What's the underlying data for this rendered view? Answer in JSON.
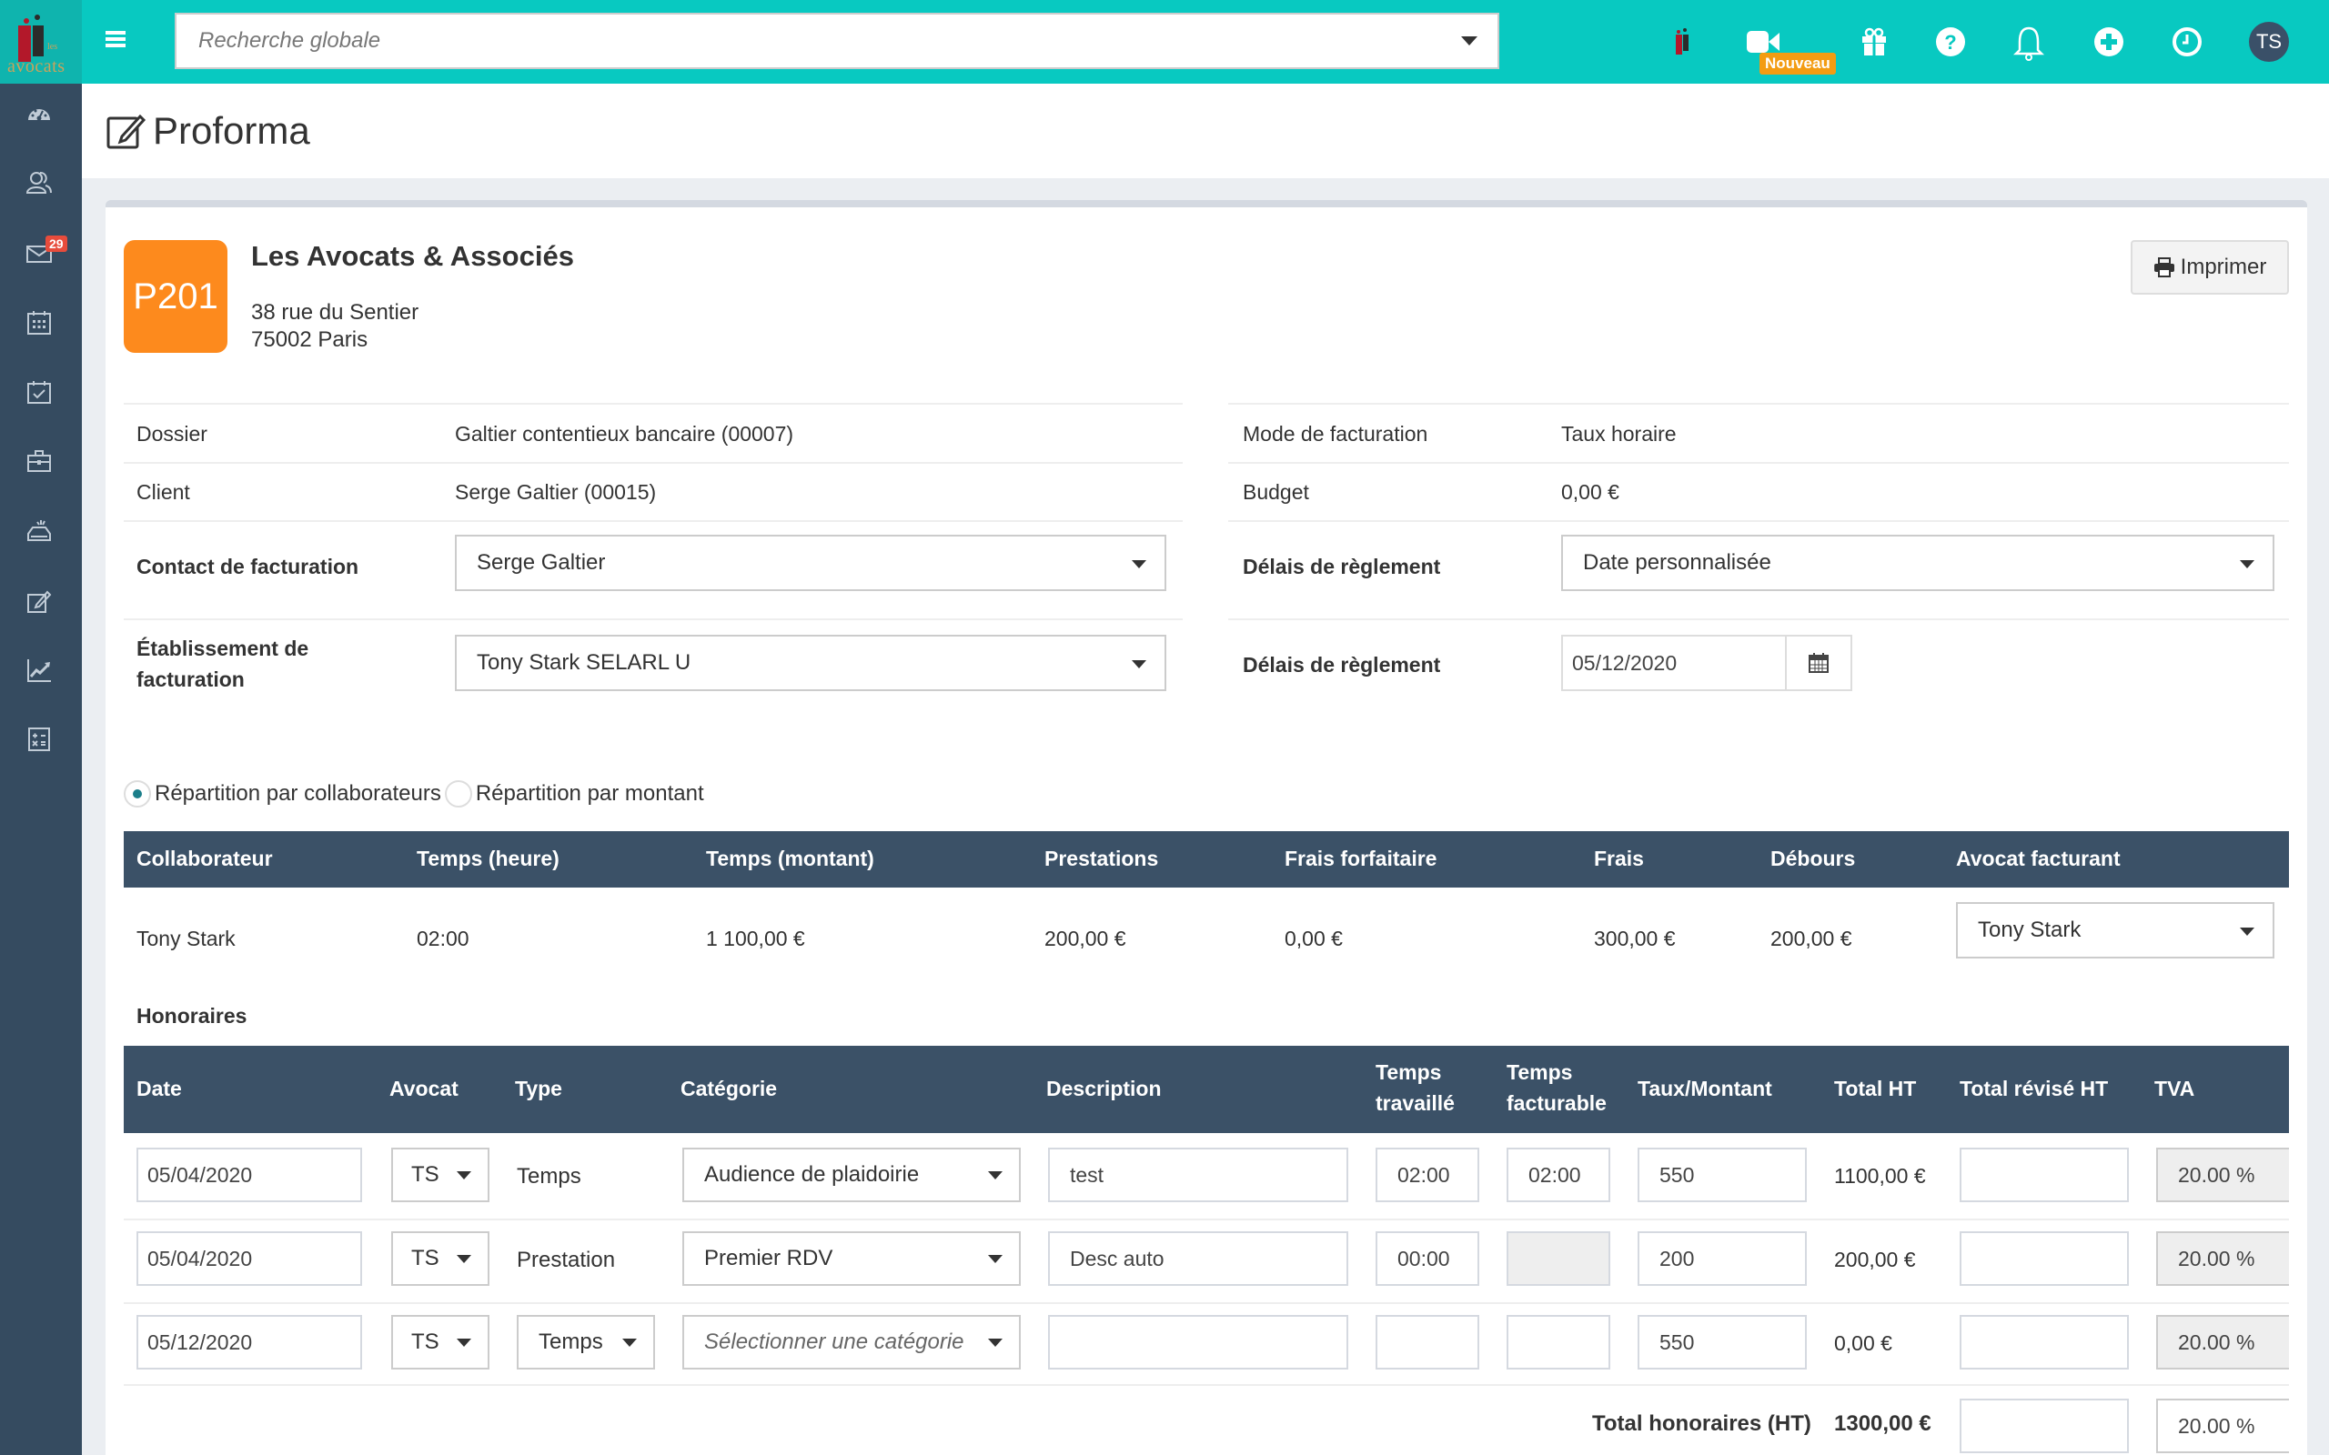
{
  "topbar": {
    "logo_text": "avocats",
    "logo_small": "les",
    "search_placeholder": "Recherche globale",
    "new_badge": "Nouveau",
    "avatar_initials": "TS",
    "icons": [
      "app-logo-icon",
      "video-icon",
      "gift-icon",
      "help-icon",
      "bell-icon",
      "plus-circle-icon",
      "clock-icon"
    ]
  },
  "sidebar": {
    "items": [
      {
        "icon": "dashboard-icon"
      },
      {
        "icon": "contacts-icon"
      },
      {
        "icon": "mail-icon",
        "badge": "29"
      },
      {
        "icon": "calendar-icon"
      },
      {
        "icon": "tasks-icon"
      },
      {
        "icon": "briefcase-icon"
      },
      {
        "icon": "inbox-icon"
      },
      {
        "icon": "edit-icon"
      },
      {
        "icon": "chart-icon"
      },
      {
        "icon": "calculator-icon"
      }
    ]
  },
  "page": {
    "title": "Proforma"
  },
  "header_card": {
    "badge": "P201",
    "firm_name": "Les Avocats & Associés",
    "address_line1": "38 rue du Sentier",
    "address_line2": "75002 Paris",
    "print_label": "Imprimer"
  },
  "details": {
    "dossier_label": "Dossier",
    "dossier_value": "Galtier contentieux bancaire (00007)",
    "client_label": "Client",
    "client_value": "Serge Galtier (00015)",
    "contact_label": "Contact de facturation",
    "contact_value": "Serge Galtier",
    "etab_label_1": "Établissement de",
    "etab_label_2": "facturation",
    "etab_value": "Tony Stark SELARL U",
    "mode_label": "Mode de facturation",
    "mode_value": "Taux horaire",
    "budget_label": "Budget",
    "budget_value": "0,00 €",
    "delais_label": "Délais de règlement",
    "delais_value": "Date personnalisée",
    "delais2_label": "Délais de règlement",
    "delais2_date": "05/12/2020"
  },
  "repartition": {
    "option1": "Répartition par collaborateurs",
    "option2": "Répartition par montant",
    "selected": 1
  },
  "collab_table": {
    "headers": [
      "Collaborateur",
      "Temps (heure)",
      "Temps (montant)",
      "Prestations",
      "Frais forfaitaire",
      "Frais",
      "Débours",
      "Avocat facturant"
    ],
    "row": [
      "Tony Stark",
      "02:00",
      "1 100,00 €",
      "200,00 €",
      "0,00 €",
      "300,00 €",
      "200,00 €",
      "Tony Stark"
    ]
  },
  "honoraires": {
    "title": "Honoraires",
    "headers": [
      "Date",
      "Avocat",
      "Type",
      "Catégorie",
      "Description",
      "Temps",
      "travaillé",
      "Temps",
      "facturable",
      "Taux/Montant",
      "Total HT",
      "Total révisé HT",
      "TVA"
    ],
    "rows": [
      {
        "date": "05/04/2020",
        "avocat": "TS",
        "type": "Temps",
        "type_select": false,
        "categorie": "Audience de plaidoirie",
        "cat_placeholder": false,
        "description": "test",
        "temps_travaille": "02:00",
        "temps_facturable": "02:00",
        "facturable_disabled": false,
        "taux": "550",
        "total_ht": "1100,00 €",
        "total_revise": "",
        "tva": "20.00 %"
      },
      {
        "date": "05/04/2020",
        "avocat": "TS",
        "type": "Prestation",
        "type_select": false,
        "categorie": "Premier RDV",
        "cat_placeholder": false,
        "description": "Desc auto",
        "temps_travaille": "00:00",
        "temps_facturable": "",
        "facturable_disabled": true,
        "taux": "200",
        "total_ht": "200,00 €",
        "total_revise": "",
        "tva": "20.00 %"
      },
      {
        "date": "05/12/2020",
        "avocat": "TS",
        "type": "Temps",
        "type_select": true,
        "categorie": "Sélectionner une catégorie",
        "cat_placeholder": true,
        "description": "",
        "temps_travaille": "",
        "temps_facturable": "",
        "facturable_disabled": false,
        "taux": "550",
        "total_ht": "0,00 €",
        "total_revise": "",
        "tva": "20.00 %"
      }
    ],
    "total_label": "Total honoraires (HT)",
    "total_value": "1300,00 €",
    "total_revise": "",
    "total_tva": "20.00 %"
  },
  "colors": {
    "topbar": "#08c9c1",
    "sidebar": "#354b60",
    "table_header": "#3b5167",
    "badge_orange": "#fd8a1d",
    "new_badge": "#f39c12",
    "notif_badge": "#e74c3c"
  }
}
